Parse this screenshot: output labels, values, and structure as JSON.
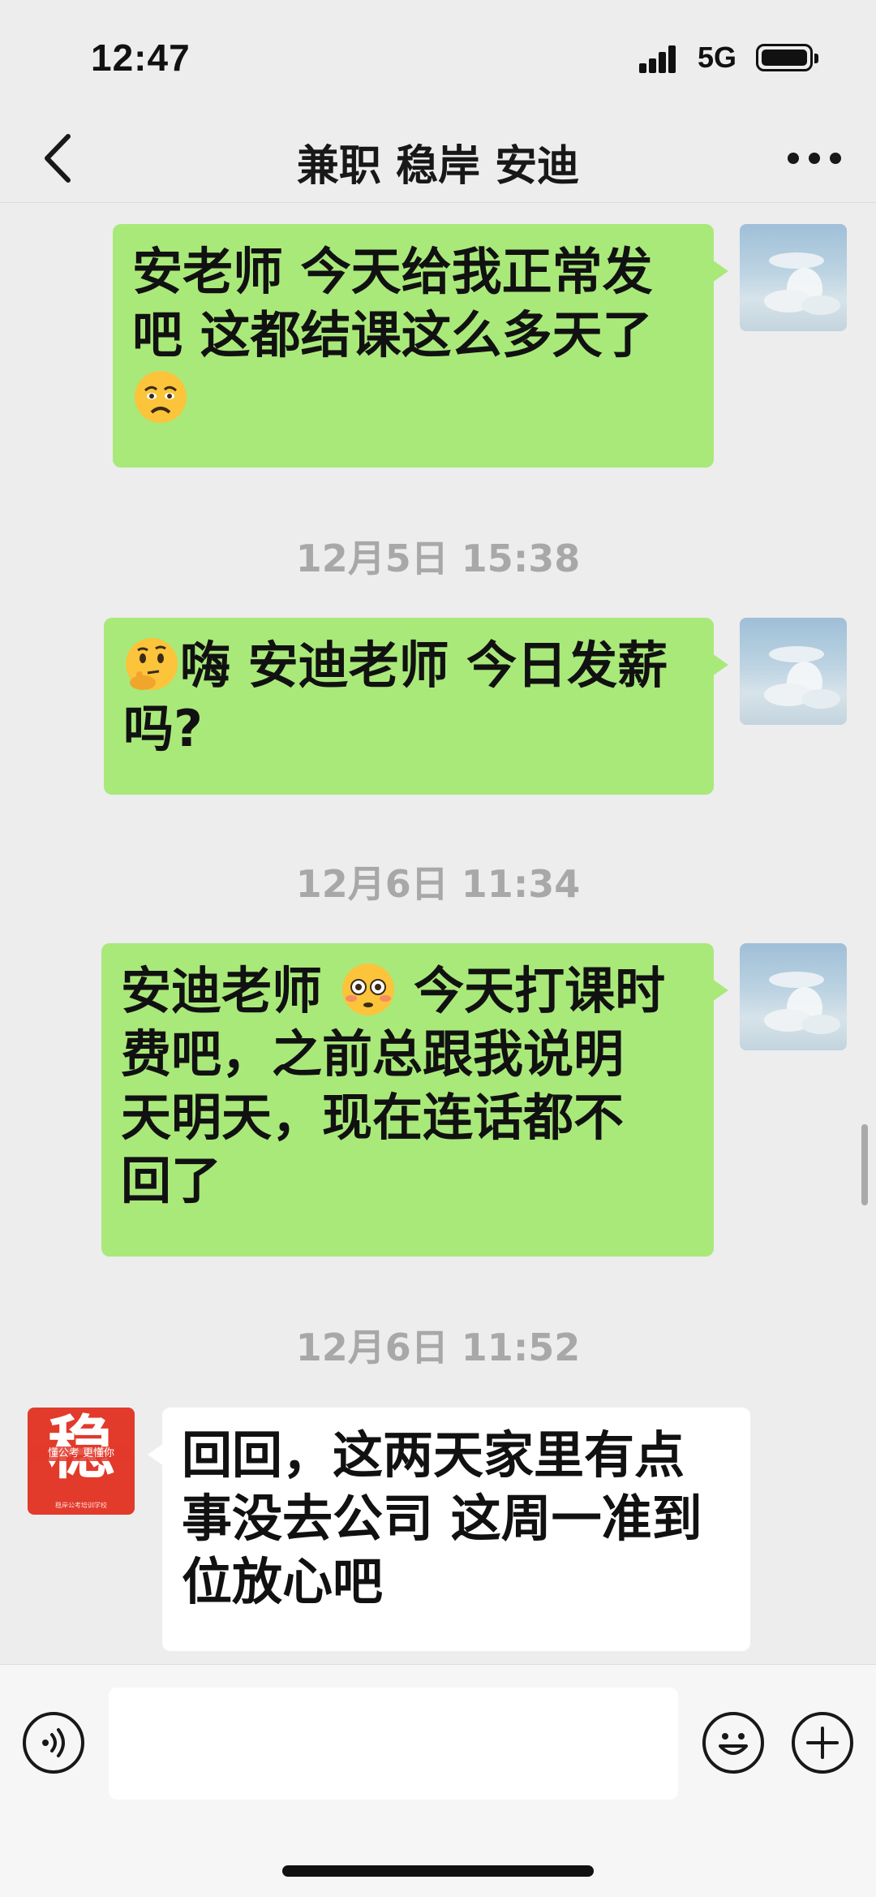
{
  "status_bar": {
    "time": "12:47",
    "network": "5G",
    "icons": [
      "signal-icon",
      "battery-icon"
    ]
  },
  "nav": {
    "title": "兼职 稳岸 安迪",
    "back_icon": "chevron-left-icon",
    "more_icon": "more-icon"
  },
  "messages": [
    {
      "direction": "sent",
      "text_lines": [
        "安老师 今天给我正常发",
        "吧 这都结课这么多天了"
      ],
      "emoji": "worried-face-emoji"
    },
    {
      "type": "timestamp",
      "text": "12月5日 15:38"
    },
    {
      "direction": "sent",
      "emoji": "thinking-face-emoji",
      "text_lines": [
        "嗨 安迪老师 今日发薪",
        "吗?"
      ]
    },
    {
      "type": "timestamp",
      "text": "12月6日 11:34"
    },
    {
      "direction": "sent",
      "text_before_emoji": "安迪老师 ",
      "emoji": "flushed-face-emoji",
      "text_after_emoji": " 今天打课时",
      "text_lines": [
        "费吧，之前总跟我说明",
        "天明天，现在连话都不",
        "回了"
      ]
    },
    {
      "type": "timestamp",
      "text": "12月6日 11:52"
    },
    {
      "direction": "received",
      "text_lines": [
        "回回，这两天家里有点",
        "事没去公司 这周一准到",
        "位放心吧"
      ]
    }
  ],
  "contact_avatar": {
    "char": "稳",
    "slogan": "懂公考 更懂你",
    "small_text": "稳岸公考培训学校"
  },
  "input_bar": {
    "placeholder": "",
    "voice_icon": "voice-icon",
    "emoji_icon": "emoji-icon",
    "plus_icon": "plus-icon"
  },
  "colors": {
    "sent_bubble": "#a9e97a",
    "received_bubble": "#ffffff",
    "background": "#ededed",
    "brand_red": "#e23a2b"
  }
}
